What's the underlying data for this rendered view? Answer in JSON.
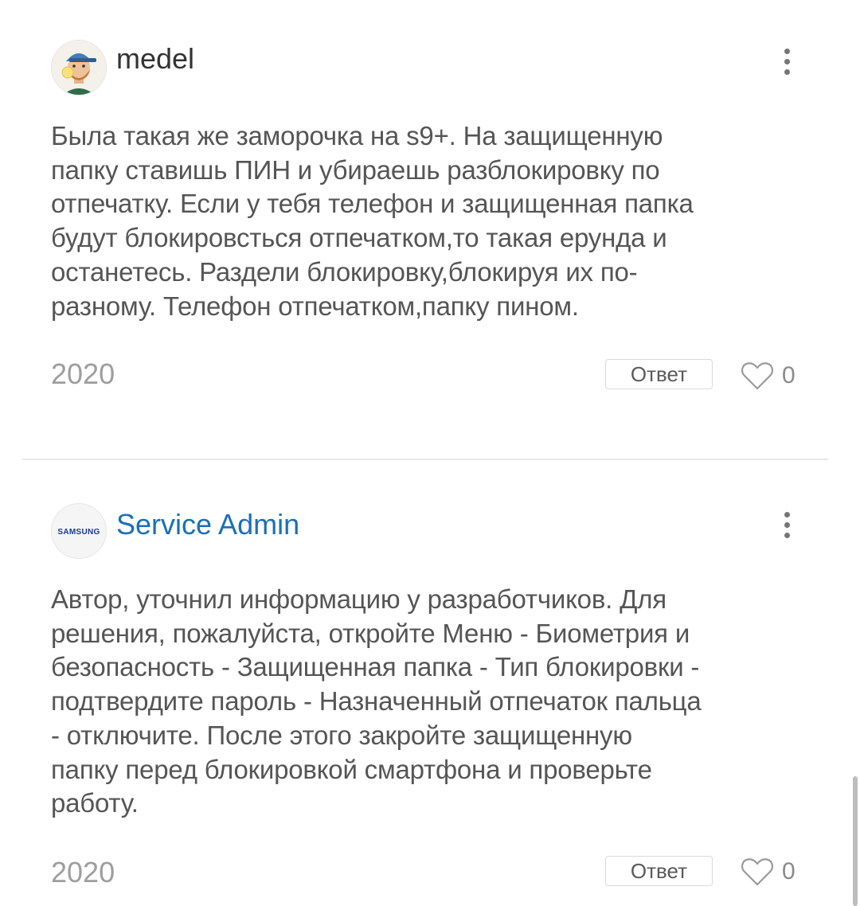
{
  "comments": [
    {
      "author": "medel",
      "avatar_icon": "user-avatar-icon",
      "body_lines": [
        "Была такая же заморочка на s9+. На защищенную",
        "папку ставишь ПИН и убираешь разблокировку по",
        "отпечатку. Если у тебя телефон и защищенная папка",
        "будут блокировсться отпечатком,то такая ерунда и",
        "останетесь. Раздели блокировку,блокируя их по-",
        "разному. Телефон отпечатком,папку пином."
      ],
      "date": "2020",
      "reply_label": "Ответ",
      "likes": "0"
    },
    {
      "author": "Service Admin",
      "author_color": "#1a6fb9",
      "avatar_logo_text": "SAMSUNG",
      "body_lines": [
        "Автор, уточнил информацию у разработчиков. Для",
        "решения, пожалуйста, откройте Меню - Биометрия и",
        "безопасность - Защищенная папка - Тип блокировки -",
        "подтвердите пароль - Назначенный отпечаток пальца",
        "- отключите. После этого закройте защищенную",
        "папку перед блокировкой смартфона и проверьте",
        "работу."
      ],
      "date": "2020",
      "reply_label": "Ответ",
      "likes": "0"
    }
  ],
  "icons": {
    "more": "more-vertical-icon",
    "like": "heart-outline-icon"
  },
  "colors": {
    "admin_name": "#1a6fb9",
    "text": "#555555",
    "muted": "#9e9e9e"
  }
}
